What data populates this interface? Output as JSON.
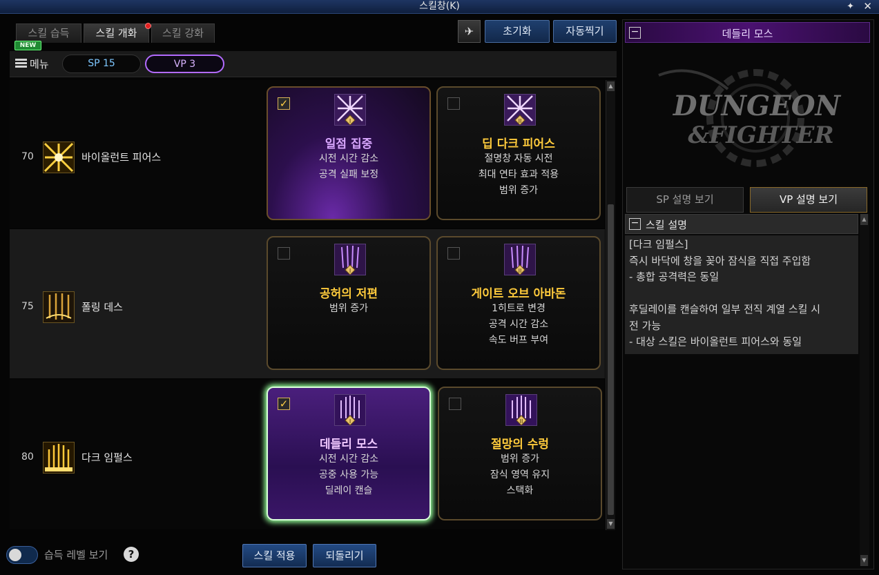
{
  "window": {
    "title": "스킬창(K)",
    "pin_icon": "pin-icon",
    "close_icon": "close-icon"
  },
  "tabs": [
    {
      "label": "스킬 습득",
      "active": false
    },
    {
      "label": "스킬 개화",
      "active": true,
      "notification": true
    },
    {
      "label": "스킬 강화",
      "active": false
    }
  ],
  "new_badge": "NEW",
  "toolbar": {
    "reset_label": "초기화",
    "auto_label": "자동찍기",
    "build_icon": "wing-icon"
  },
  "menu": {
    "label": "메뉴",
    "sp": "SP 15",
    "vp": "VP 3"
  },
  "skills": [
    {
      "level": "70",
      "name": "바이올런트 피어스",
      "options": [
        {
          "checked": true,
          "title": "일점 집중",
          "desc": [
            "시전 시간 감소",
            "공격 실패 보정"
          ],
          "tier": "I"
        },
        {
          "checked": false,
          "title": "딥 다크 피어스",
          "desc": [
            "절명창 자동 시전",
            "최대 연타 효과 적용",
            "범위 증가"
          ],
          "tier": "II"
        }
      ]
    },
    {
      "level": "75",
      "name": "폴링 데스",
      "options": [
        {
          "checked": false,
          "title": "공허의 저편",
          "desc": [
            "범위 증가"
          ],
          "tier": "I"
        },
        {
          "checked": false,
          "title": "게이트 오브 아바돈",
          "desc": [
            "1히트로 변경",
            "공격 시간 감소",
            "속도 버프 부여"
          ],
          "tier": "II"
        }
      ]
    },
    {
      "level": "80",
      "name": "다크 임펄스",
      "options": [
        {
          "checked": true,
          "title": "데들리 모스",
          "desc": [
            "시전 시간 감소",
            "공중 사용 가능",
            "딜레이 캔슬"
          ],
          "tier": "I"
        },
        {
          "checked": false,
          "title": "절망의 수렁",
          "desc": [
            "범위 증가",
            "잠식 영역 유지",
            "스택화"
          ],
          "tier": "II"
        }
      ]
    }
  ],
  "bottom": {
    "level_view_label": "습득 레벨 보기",
    "help": "?",
    "apply_label": "스킬 적용",
    "revert_label": "되돌리기"
  },
  "right_panel": {
    "title": "데들리 모스",
    "logo_line1": "DUNGEON",
    "logo_line2": "&FIGHTER",
    "sp_tab": "SP 설명 보기",
    "vp_tab": "VP 설명 보기",
    "desc_header": "스킬 설명",
    "desc_lines": [
      "[다크 임펄스]",
      "즉시 바닥에 창을 꽂아 잠식을 직접 주입함",
      " - 총합 공격력은 동일",
      "",
      "후딜레이를 캔슬하여 일부 전직 계열 스킬 시",
      "전 가능",
      " - 대상 스킬은 바이올런트 피어스와 동일"
    ]
  }
}
